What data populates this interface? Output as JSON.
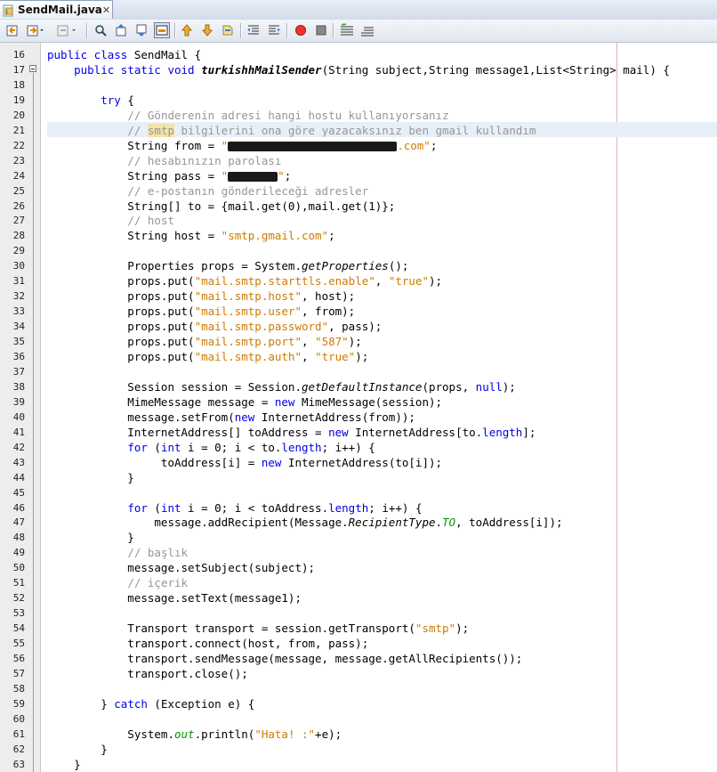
{
  "tab": {
    "title": "SendMail.java",
    "close": "✕"
  },
  "toolbar": {
    "buttons": [
      "back-button",
      "history-button",
      "forward-button",
      "find-button",
      "find-previous-button",
      "find-next-button",
      "toggle-highlight-button",
      "previous-bookmark-button",
      "next-bookmark-button",
      "toggle-bookmark-button",
      "shift-left-button",
      "shift-right-button",
      "start-macro-button",
      "stop-macro-button",
      "comment-button",
      "uncomment-button"
    ]
  },
  "lines": [
    {
      "n": "16",
      "html": "<span class='kw'>public class</span> SendMail {"
    },
    {
      "n": "17",
      "html": "    <span class='kw'>public static void</span> <span class='bold'>turkishhMailSender</span>(String subject,String message1,List&lt;String&gt; mail) {"
    },
    {
      "n": "18",
      "html": ""
    },
    {
      "n": "19",
      "html": "        <span class='kw'>try</span> {"
    },
    {
      "n": "20",
      "html": "            <span class='cm'>// Gönderenin adresi hangi hostu kullanıyorsanız</span>"
    },
    {
      "n": "21",
      "html": "            <span class='cm'>// <span class='mark'>smtp</span> bilgilerini ona göre yazacaksınız ben gmail kullandım</span>"
    },
    {
      "n": "22",
      "html": "            String from = <span class='str'>\"<span class='redact' style='width:190px'></span>.com\"</span>;"
    },
    {
      "n": "23",
      "html": "            <span class='cm'>// hesabınızın parolası</span>"
    },
    {
      "n": "24",
      "html": "            String pass = <span class='str'>\"<span class='redact' style='width:56px'></span>\"</span>;"
    },
    {
      "n": "25",
      "html": "            <span class='cm'>// e-postanın gönderileceği adresler</span>"
    },
    {
      "n": "26",
      "html": "            String[] to = {mail.get(0),mail.get(1)};"
    },
    {
      "n": "27",
      "html": "            <span class='cm'>// host</span>"
    },
    {
      "n": "28",
      "html": "            String host = <span class='str'>\"smtp.gmail.com\"</span>;"
    },
    {
      "n": "29",
      "html": ""
    },
    {
      "n": "30",
      "html": "            Properties props = System.<span class='it'>getProperties</span>();"
    },
    {
      "n": "31",
      "html": "            props.put(<span class='str'>\"mail.smtp.starttls.enable\"</span>, <span class='str'>\"true\"</span>);"
    },
    {
      "n": "32",
      "html": "            props.put(<span class='str'>\"mail.smtp.host\"</span>, host);"
    },
    {
      "n": "33",
      "html": "            props.put(<span class='str'>\"mail.smtp.user\"</span>, from);"
    },
    {
      "n": "34",
      "html": "            props.put(<span class='str'>\"mail.smtp.password\"</span>, pass);"
    },
    {
      "n": "35",
      "html": "            props.put(<span class='str'>\"mail.smtp.port\"</span>, <span class='str'>\"587\"</span>);"
    },
    {
      "n": "36",
      "html": "            props.put(<span class='str'>\"mail.smtp.auth\"</span>, <span class='str'>\"true\"</span>);"
    },
    {
      "n": "37",
      "html": ""
    },
    {
      "n": "38",
      "html": "            Session session = Session.<span class='it'>getDefaultInstance</span>(props, <span class='kw'>null</span>);"
    },
    {
      "n": "39",
      "html": "            MimeMessage message = <span class='kw'>new</span> MimeMessage(session);"
    },
    {
      "n": "40",
      "html": "            message.setFrom(<span class='kw'>new</span> InternetAddress(from));"
    },
    {
      "n": "41",
      "html": "            InternetAddress[] toAddress = <span class='kw'>new</span> InternetAddress[to.<span class='kw'>length</span>];"
    },
    {
      "n": "42",
      "html": "            <span class='kw'>for</span> (<span class='kw'>int</span> i = 0; i &lt; to.<span class='kw'>length</span>; i++) {"
    },
    {
      "n": "43",
      "html": "                 toAddress[i] = <span class='kw'>new</span> InternetAddress(to[i]);"
    },
    {
      "n": "44",
      "html": "            }"
    },
    {
      "n": "45",
      "html": ""
    },
    {
      "n": "46",
      "html": "            <span class='kw'>for</span> (<span class='kw'>int</span> i = 0; i &lt; toAddress.<span class='kw'>length</span>; i++) {"
    },
    {
      "n": "47",
      "html": "                message.addRecipient(Message.<span class='it'>RecipientType</span>.<span class='fld'>TO</span>, toAddress[i]);"
    },
    {
      "n": "48",
      "html": "            }"
    },
    {
      "n": "49",
      "html": "            <span class='cm'>// başlık</span>"
    },
    {
      "n": "50",
      "html": "            message.setSubject(subject);"
    },
    {
      "n": "51",
      "html": "            <span class='cm'>// içerik</span>"
    },
    {
      "n": "52",
      "html": "            message.setText(message1);"
    },
    {
      "n": "53",
      "html": ""
    },
    {
      "n": "54",
      "html": "            Transport transport = session.getTransport(<span class='str'>\"smtp\"</span>);"
    },
    {
      "n": "55",
      "html": "            transport.connect(host, from, pass);"
    },
    {
      "n": "56",
      "html": "            transport.sendMessage(message, message.getAllRecipients());"
    },
    {
      "n": "57",
      "html": "            transport.close();"
    },
    {
      "n": "58",
      "html": ""
    },
    {
      "n": "59",
      "html": "        } <span class='kw'>catch</span> (Exception e) {"
    },
    {
      "n": "60",
      "html": ""
    },
    {
      "n": "61",
      "html": "            System.<span class='fld'>out</span>.println(<span class='str'>\"Hata! :\"</span>+e);"
    },
    {
      "n": "62",
      "html": "        }"
    },
    {
      "n": "63",
      "html": "    }"
    }
  ]
}
